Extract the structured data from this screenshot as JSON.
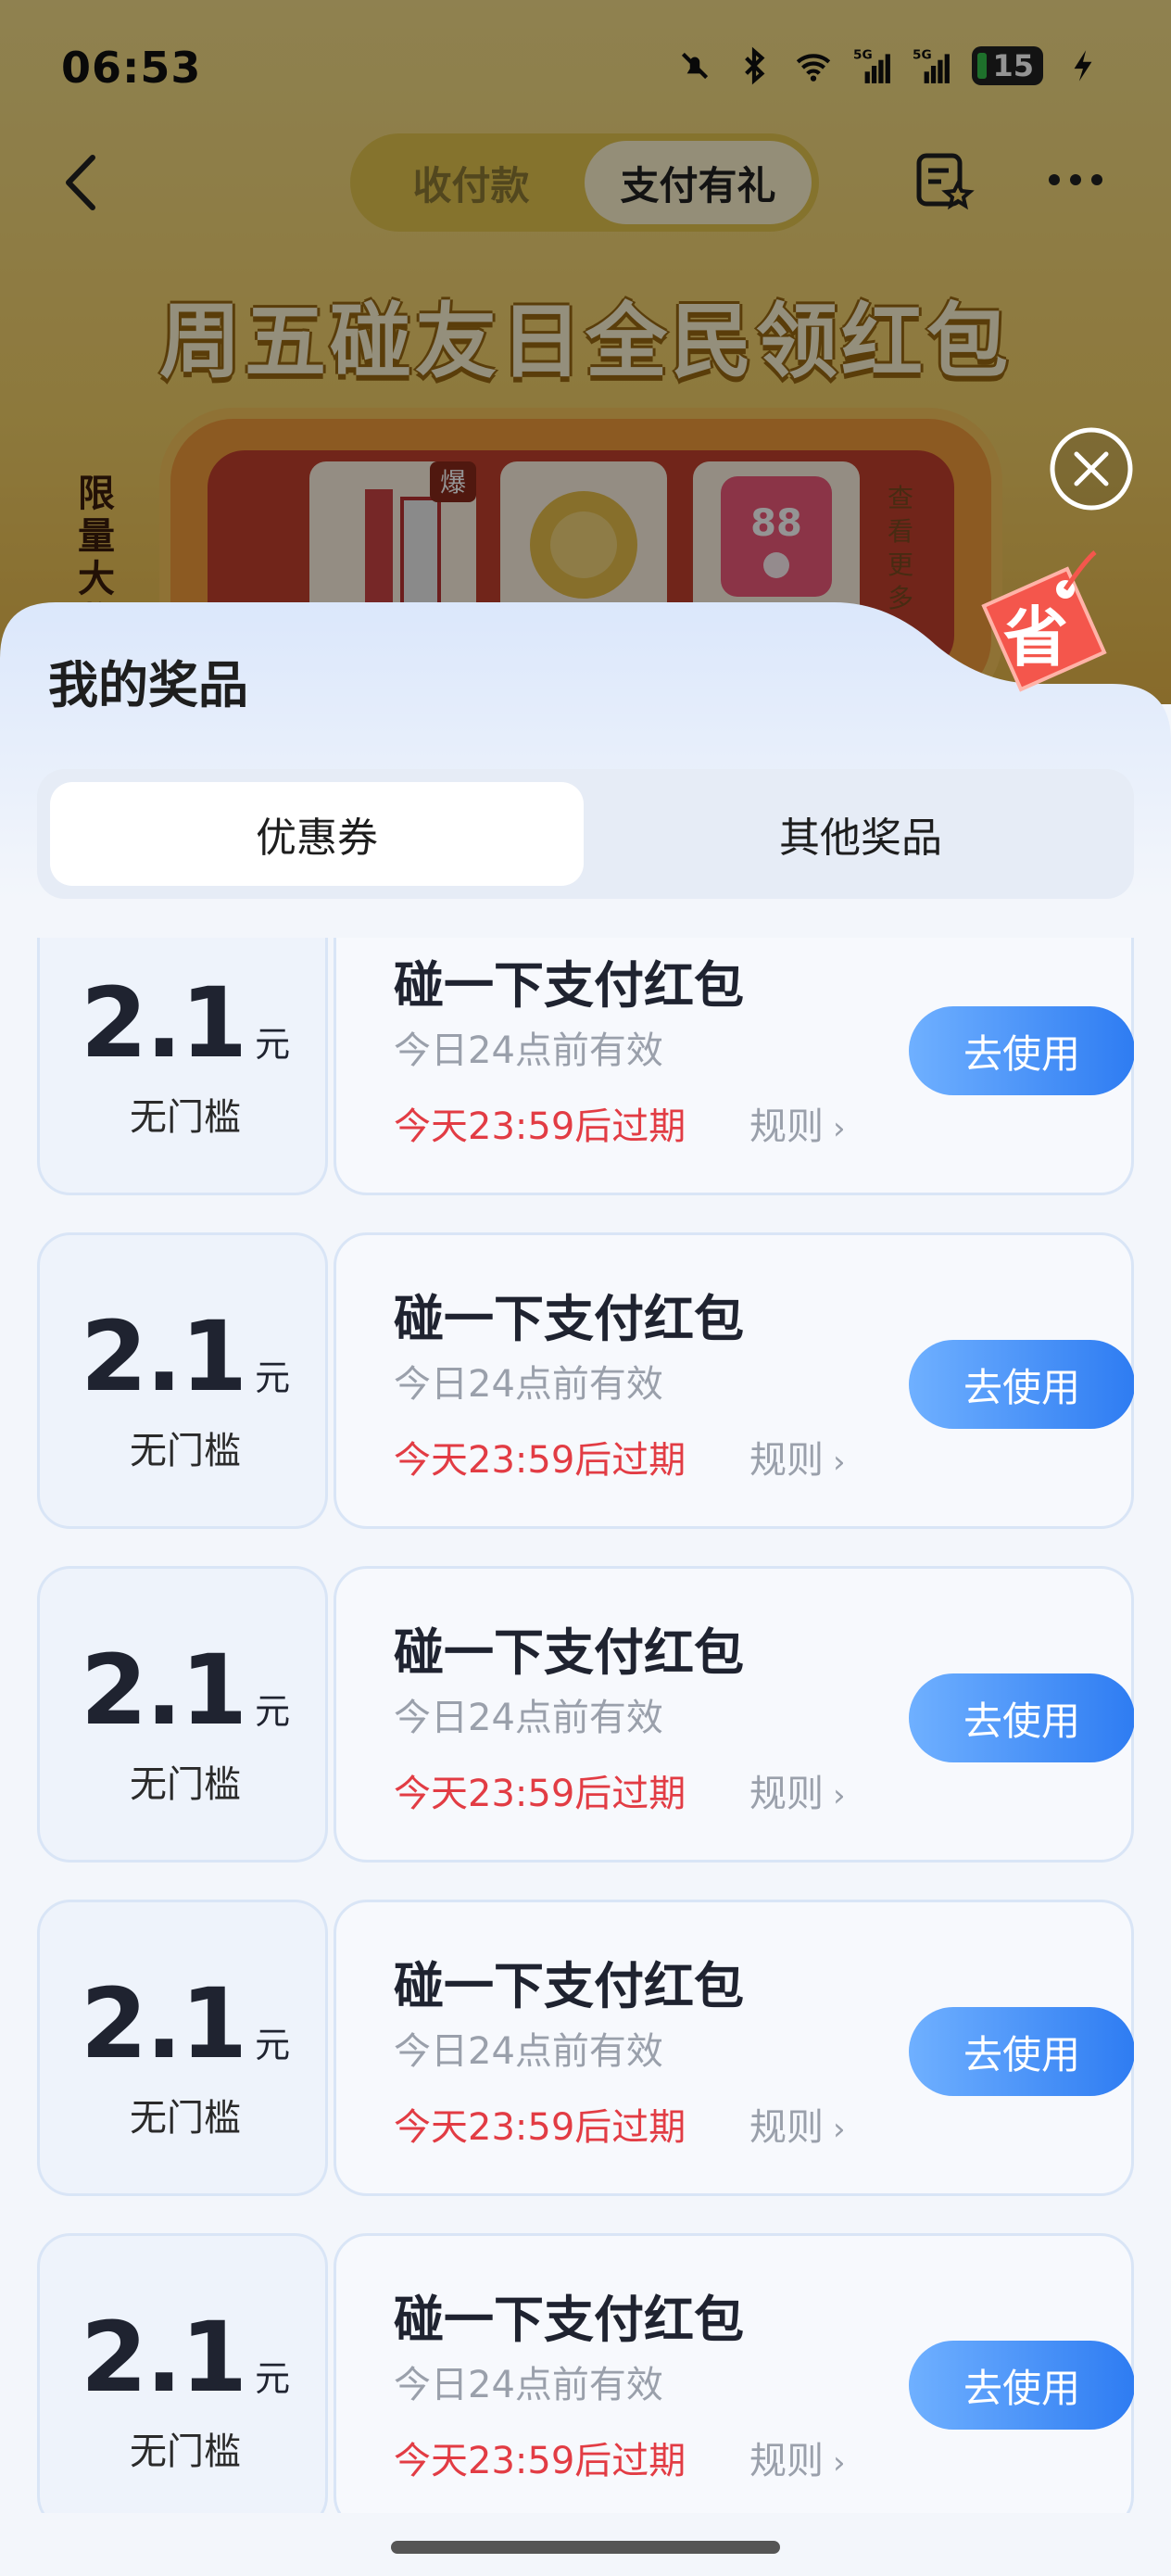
{
  "status_bar": {
    "time": "06:53",
    "battery": "15",
    "signal_labels": [
      "5G",
      "5G"
    ]
  },
  "background": {
    "segment_tabs": [
      {
        "label": "收付款"
      },
      {
        "label": "支付有礼"
      }
    ],
    "banner_title": "周五碰友日全民领红包",
    "limit_label": "限量大奖",
    "prize_badge": "爆",
    "prize_value": "88",
    "see_more": "查看更多"
  },
  "sheet": {
    "title": "我的奖品",
    "save_tag": "省",
    "tabs": [
      {
        "label": "优惠券"
      },
      {
        "label": "其他奖品"
      }
    ],
    "coupons": [
      {
        "amount": "2.1",
        "unit": "元",
        "condition": "无门槛",
        "title": "碰一下支付红包",
        "validity": "今日24点前有效",
        "expiry": "今天23:59后过期",
        "rule": "规则",
        "button": "去使用"
      },
      {
        "amount": "2.1",
        "unit": "元",
        "condition": "无门槛",
        "title": "碰一下支付红包",
        "validity": "今日24点前有效",
        "expiry": "今天23:59后过期",
        "rule": "规则",
        "button": "去使用"
      },
      {
        "amount": "2.1",
        "unit": "元",
        "condition": "无门槛",
        "title": "碰一下支付红包",
        "validity": "今日24点前有效",
        "expiry": "今天23:59后过期",
        "rule": "规则",
        "button": "去使用"
      },
      {
        "amount": "2.1",
        "unit": "元",
        "condition": "无门槛",
        "title": "碰一下支付红包",
        "validity": "今日24点前有效",
        "expiry": "今天23:59后过期",
        "rule": "规则",
        "button": "去使用"
      },
      {
        "amount": "2.1",
        "unit": "元",
        "condition": "无门槛",
        "title": "碰一下支付红包",
        "validity": "今日24点前有效",
        "expiry": "今天23:59后过期",
        "rule": "规则",
        "button": "去使用"
      }
    ]
  },
  "colors": {
    "accent": "#2e7cf2",
    "expiry": "#e23c44"
  }
}
